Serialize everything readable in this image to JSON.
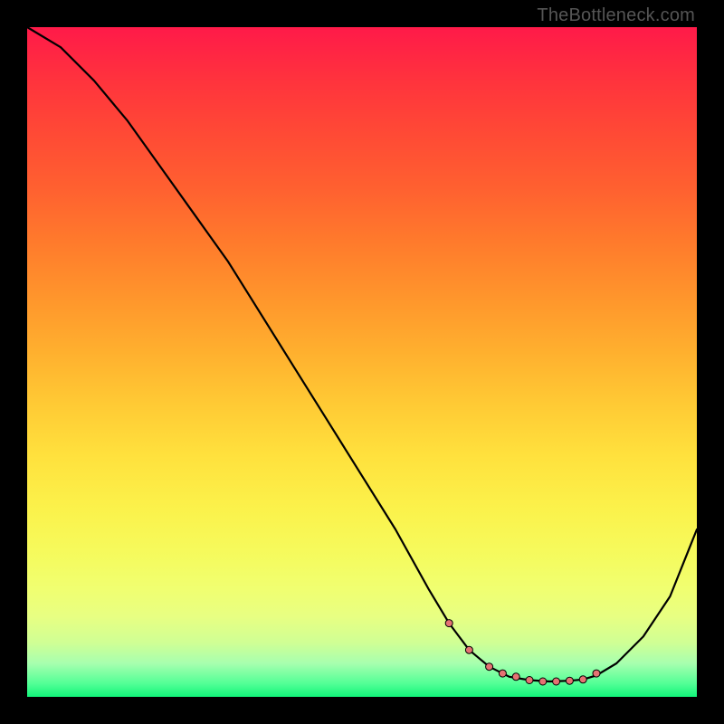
{
  "watermark": "TheBottleneck.com",
  "colors": {
    "curve_stroke": "#000000",
    "dot_fill": "#e57373",
    "dot_stroke": "#000000"
  },
  "chart_data": {
    "type": "line",
    "title": "",
    "xlabel": "",
    "ylabel": "",
    "xlim": [
      0,
      100
    ],
    "ylim": [
      0,
      100
    ],
    "grid": false,
    "x": [
      0,
      5,
      10,
      15,
      20,
      25,
      30,
      35,
      40,
      45,
      50,
      55,
      60,
      63,
      66,
      69,
      72,
      75,
      78,
      81,
      83,
      85,
      88,
      92,
      96,
      100
    ],
    "values": [
      100,
      97,
      92,
      86,
      79,
      72,
      65,
      57,
      49,
      41,
      33,
      25,
      16,
      11,
      7,
      4.5,
      3,
      2.5,
      2.3,
      2.4,
      2.6,
      3.2,
      5,
      9,
      15,
      25
    ],
    "dots_x": [
      63,
      66,
      69,
      71,
      73,
      75,
      77,
      79,
      81,
      83,
      85
    ],
    "dots_values": [
      11,
      7,
      4.5,
      3.5,
      3,
      2.5,
      2.3,
      2.3,
      2.4,
      2.6,
      3.5
    ],
    "dot_radius": 4
  }
}
